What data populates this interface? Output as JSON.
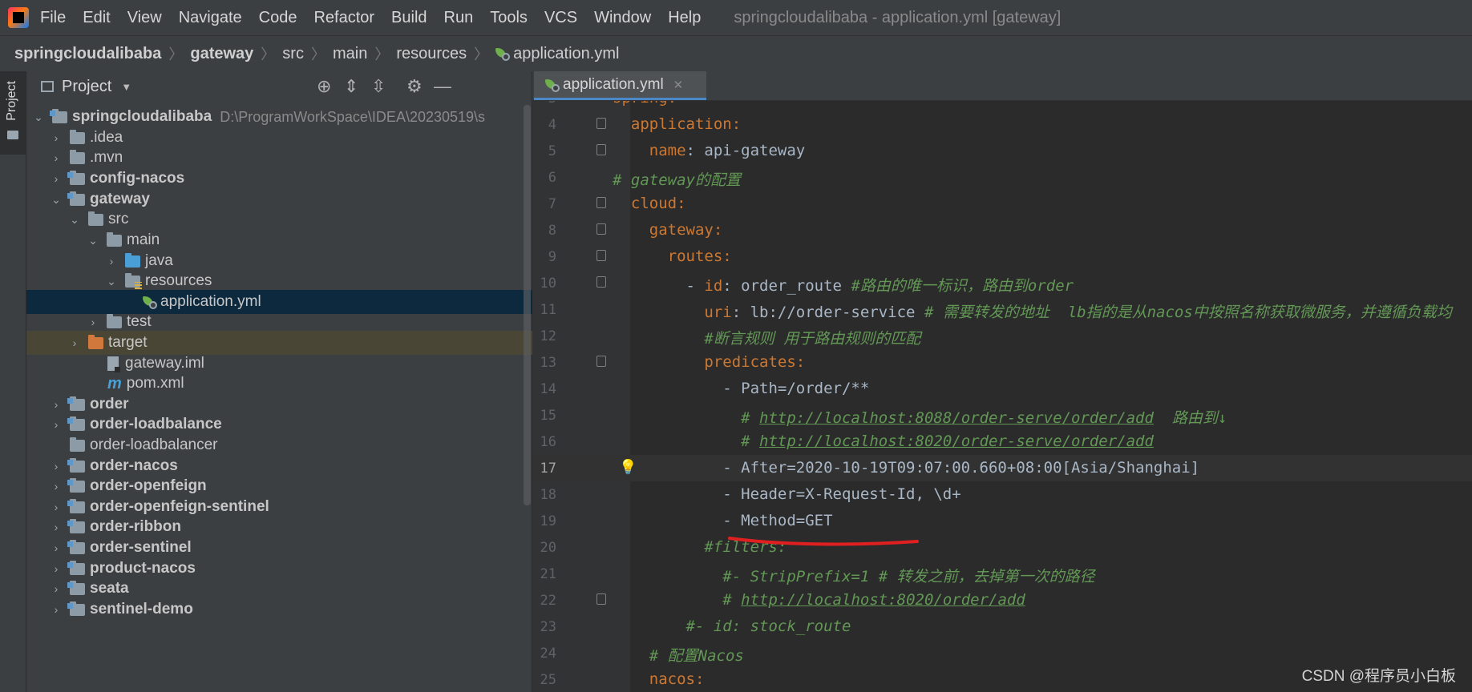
{
  "menubar": {
    "items": [
      "File",
      "Edit",
      "View",
      "Navigate",
      "Code",
      "Refactor",
      "Build",
      "Run",
      "Tools",
      "VCS",
      "Window",
      "Help"
    ],
    "window_title": "springcloudalibaba - application.yml [gateway]"
  },
  "breadcrumb": [
    "springcloudalibaba",
    "gateway",
    "src",
    "main",
    "resources",
    "application.yml"
  ],
  "sidebar": {
    "tab_label": "Project"
  },
  "project_panel": {
    "title": "Project",
    "tree": [
      {
        "label": "springcloudalibaba",
        "path": "D:\\ProgramWorkSpace\\IDEA\\20230519\\s"
      },
      {
        "label": ".idea"
      },
      {
        "label": ".mvn"
      },
      {
        "label": "config-nacos"
      },
      {
        "label": "gateway"
      },
      {
        "label": "src"
      },
      {
        "label": "main"
      },
      {
        "label": "java"
      },
      {
        "label": "resources"
      },
      {
        "label": "application.yml"
      },
      {
        "label": "test"
      },
      {
        "label": "target"
      },
      {
        "label": "gateway.iml"
      },
      {
        "label": "pom.xml"
      },
      {
        "label": "order"
      },
      {
        "label": "order-loadbalance"
      },
      {
        "label": "order-loadbalancer"
      },
      {
        "label": "order-nacos"
      },
      {
        "label": "order-openfeign"
      },
      {
        "label": "order-openfeign-sentinel"
      },
      {
        "label": "order-ribbon"
      },
      {
        "label": "order-sentinel"
      },
      {
        "label": "product-nacos"
      },
      {
        "label": "seata"
      },
      {
        "label": "sentinel-demo"
      }
    ]
  },
  "editor": {
    "tab_label": "application.yml",
    "current_line": 17,
    "lines": [
      {
        "n": "3",
        "seg": [
          [
            "k",
            "spring:"
          ]
        ]
      },
      {
        "n": "4",
        "seg": [
          [
            "s",
            "  "
          ],
          [
            "k",
            "application:"
          ]
        ]
      },
      {
        "n": "5",
        "seg": [
          [
            "s",
            "    "
          ],
          [
            "k",
            "name"
          ],
          [
            "s",
            ": api-gateway"
          ]
        ]
      },
      {
        "n": "6",
        "seg": [
          [
            "c",
            "# gateway的配置"
          ]
        ]
      },
      {
        "n": "7",
        "seg": [
          [
            "s",
            "  "
          ],
          [
            "k",
            "cloud:"
          ]
        ]
      },
      {
        "n": "8",
        "seg": [
          [
            "s",
            "    "
          ],
          [
            "k",
            "gateway:"
          ]
        ]
      },
      {
        "n": "9",
        "seg": [
          [
            "s",
            "      "
          ],
          [
            "k",
            "routes:"
          ]
        ]
      },
      {
        "n": "10",
        "seg": [
          [
            "s",
            "        - "
          ],
          [
            "k",
            "id"
          ],
          [
            "s",
            ": order_route "
          ],
          [
            "c",
            "#路由的唯一标识，路由到order"
          ]
        ]
      },
      {
        "n": "11",
        "seg": [
          [
            "s",
            "          "
          ],
          [
            "k",
            "uri"
          ],
          [
            "s",
            ": lb://order-service "
          ],
          [
            "c",
            "# 需要转发的地址  lb指的是从nacos中按照名称获取微服务，并遵循负载均"
          ]
        ]
      },
      {
        "n": "12",
        "seg": [
          [
            "s",
            "          "
          ],
          [
            "c",
            "#断言规则 用于路由规则的匹配"
          ]
        ]
      },
      {
        "n": "13",
        "seg": [
          [
            "s",
            "          "
          ],
          [
            "k",
            "predicates:"
          ]
        ]
      },
      {
        "n": "14",
        "seg": [
          [
            "s",
            "            - Path=/order/**"
          ]
        ]
      },
      {
        "n": "15",
        "seg": [
          [
            "s",
            "              "
          ],
          [
            "c",
            "# "
          ],
          [
            "u",
            "http://localhost:8088/order-serve/order/add"
          ],
          [
            "c",
            "  路由到↓"
          ]
        ]
      },
      {
        "n": "16",
        "seg": [
          [
            "s",
            "              "
          ],
          [
            "c",
            "# "
          ],
          [
            "u",
            "http://localhost:8020/order-serve/order/add"
          ]
        ]
      },
      {
        "n": "17",
        "seg": [
          [
            "s",
            "            - After=2020-10-19T09:07:00.660+08:00[Asia/Shanghai]"
          ]
        ]
      },
      {
        "n": "18",
        "seg": [
          [
            "s",
            "            - Header=X-Request-Id, \\d+"
          ]
        ]
      },
      {
        "n": "19",
        "seg": [
          [
            "s",
            "            - Method=GET"
          ]
        ]
      },
      {
        "n": "20",
        "seg": [
          [
            "s",
            "          "
          ],
          [
            "c",
            "#filters:"
          ]
        ]
      },
      {
        "n": "21",
        "seg": [
          [
            "s",
            "            "
          ],
          [
            "c",
            "#- StripPrefix=1 # 转发之前，去掉第一次的路径"
          ]
        ]
      },
      {
        "n": "22",
        "seg": [
          [
            "s",
            "            "
          ],
          [
            "c",
            "# "
          ],
          [
            "u",
            "http://localhost:8020/order/add"
          ]
        ]
      },
      {
        "n": "23",
        "seg": [
          [
            "s",
            "        "
          ],
          [
            "c",
            "#- id: stock_route"
          ]
        ]
      },
      {
        "n": "24",
        "seg": [
          [
            "s",
            "    "
          ],
          [
            "c",
            "# 配置Nacos"
          ]
        ]
      },
      {
        "n": "25",
        "seg": [
          [
            "s",
            "    "
          ],
          [
            "k",
            "nacos:"
          ]
        ]
      }
    ]
  },
  "watermark": "CSDN @程序员小白板"
}
